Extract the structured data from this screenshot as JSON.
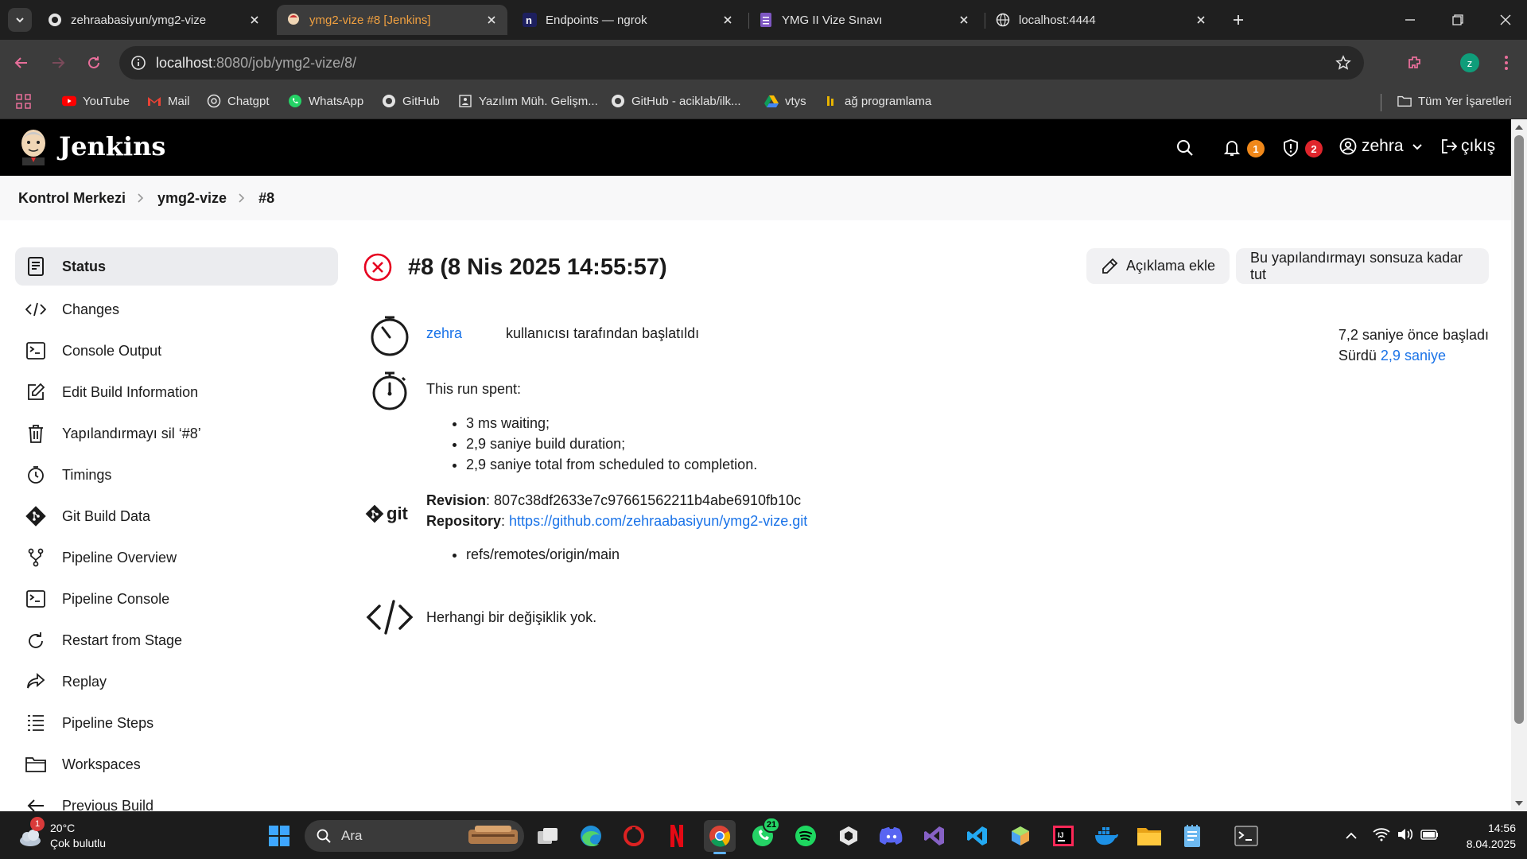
{
  "tabs": [
    {
      "title": "zehraabasiyun/ymg2-vize",
      "icon": "github-icon",
      "active": false
    },
    {
      "title": "ymg2-vize #8 [Jenkins]",
      "icon": "jenkins-icon",
      "active": true
    },
    {
      "title": "Endpoints — ngrok",
      "icon": "ngrok-icon",
      "active": false
    },
    {
      "title": "YMG II Vize Sınavı",
      "icon": "forms-icon",
      "active": false
    },
    {
      "title": "localhost:4444",
      "icon": "globe-icon",
      "active": false
    }
  ],
  "address": {
    "host": "localhost",
    "path": ":8080/job/ymg2-vize/8/"
  },
  "profile_initial": "z",
  "bookmarks": [
    {
      "label": "YouTube",
      "icon": "youtube-icon"
    },
    {
      "label": "Mail",
      "icon": "gmail-icon"
    },
    {
      "label": "Chatgpt",
      "icon": "chatgpt-icon"
    },
    {
      "label": "WhatsApp",
      "icon": "whatsapp-icon"
    },
    {
      "label": "GitHub",
      "icon": "github-icon"
    },
    {
      "label": "Yazılım Müh. Gelişm...",
      "icon": "page-icon"
    },
    {
      "label": "GitHub - aciklab/ilk...",
      "icon": "github-icon"
    },
    {
      "label": "vtys",
      "icon": "drive-icon"
    },
    {
      "label": "ağ programlama",
      "icon": "bookmark-icon"
    }
  ],
  "all_bookmarks": "Tüm Yer İşaretleri",
  "jenkins": {
    "title": "Jenkins",
    "notifications_count": "1",
    "security_count": "2",
    "user": "zehra",
    "logout": "çıkış"
  },
  "breadcrumb": [
    "Kontrol Merkezi",
    "ymg2-vize",
    "#8"
  ],
  "sidebar": [
    {
      "label": "Status",
      "icon": "status-icon"
    },
    {
      "label": "Changes",
      "icon": "code-icon"
    },
    {
      "label": "Console Output",
      "icon": "terminal-icon"
    },
    {
      "label": "Edit Build Information",
      "icon": "edit-icon"
    },
    {
      "label": "Yapılandırmayı sil ‘#8’",
      "icon": "trash-icon"
    },
    {
      "label": "Timings",
      "icon": "stopwatch-icon"
    },
    {
      "label": "Git Build Data",
      "icon": "git-icon"
    },
    {
      "label": "Pipeline Overview",
      "icon": "pipeline-icon"
    },
    {
      "label": "Pipeline Console",
      "icon": "terminal-icon"
    },
    {
      "label": "Restart from Stage",
      "icon": "restart-icon"
    },
    {
      "label": "Replay",
      "icon": "replay-icon"
    },
    {
      "label": "Pipeline Steps",
      "icon": "steps-icon"
    },
    {
      "label": "Workspaces",
      "icon": "folder-icon"
    },
    {
      "label": "Previous Build",
      "icon": "arrow-left-icon"
    }
  ],
  "build": {
    "title": "#8 (8 Nis 2025 14:55:57)",
    "status": "failed",
    "add_description": "Açıklama ekle",
    "keep_forever": "Bu yapılandırmayı sonsuza kadar tut",
    "started_by_user": "zehra",
    "started_by_suffix": "kullanıcısı tarafından başlatıldı",
    "started_ago": "7,2 saniye önce başladı",
    "took_prefix": "Sürdü",
    "took_value": "2,9 saniye",
    "run_spent_label": "This run spent:",
    "run_spent": [
      "3 ms waiting;",
      "2,9 saniye build duration;",
      "2,9 saniye total from scheduled to completion."
    ],
    "revision_label": "Revision",
    "revision": "807c38df2633e7c97661562211b4abe6910fb10c",
    "repository_label": "Repository",
    "repository_url": "https://github.com/zehraabasiyun/ymg2-vize.git",
    "branches": [
      "refs/remotes/origin/main"
    ],
    "no_changes": "Herhangi bir değişiklik yok."
  },
  "taskbar": {
    "weather_temp": "20°C",
    "weather_desc": "Çok bulutlu",
    "weather_badge": "1",
    "search_label": "Ara",
    "whatsapp_badge": "21",
    "time": "14:56",
    "date": "8.04.2025"
  }
}
